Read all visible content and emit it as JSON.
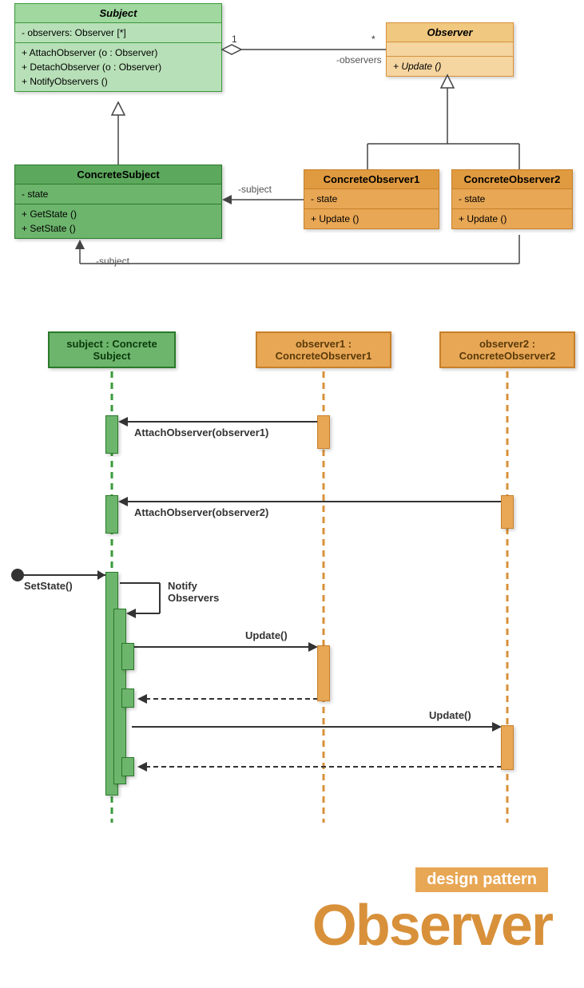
{
  "classes": {
    "subject": {
      "name": "Subject",
      "attrs": [
        "- observers: Observer [*]"
      ],
      "ops": [
        "+ AttachObserver (o : Observer)",
        "+ DetachObserver (o : Observer)",
        "+ NotifyObservers ()"
      ]
    },
    "observer": {
      "name": "Observer",
      "ops": [
        "+ Update ()"
      ]
    },
    "concreteSubject": {
      "name": "ConcreteSubject",
      "attrs": [
        "- state"
      ],
      "ops": [
        "+ GetState ()",
        "+ SetState ()"
      ]
    },
    "concreteObserver1": {
      "name": "ConcreteObserver1",
      "attrs": [
        "- state"
      ],
      "ops": [
        "+ Update ()"
      ]
    },
    "concreteObserver2": {
      "name": "ConcreteObserver2",
      "attrs": [
        "- state"
      ],
      "ops": [
        "+ Update ()"
      ]
    }
  },
  "assoc": {
    "subject_observer": {
      "mult_left": "1",
      "mult_right": "*",
      "role": "-observers"
    },
    "co1_cs": {
      "role": "-subject"
    },
    "co2_cs": {
      "role": "-subject"
    }
  },
  "sequence": {
    "lifelines": {
      "subject": "subject : Concrete Subject",
      "observer1": "observer1 : ConcreteObserver1",
      "observer2": "observer2 : ConcreteObserver2"
    },
    "messages": {
      "attach1": "AttachObserver(observer1)",
      "attach2": "AttachObserver(observer2)",
      "setstate": "SetState()",
      "notify": "Notify Observers",
      "update1": "Update()",
      "update2": "Update()"
    }
  },
  "title": {
    "sub": "design pattern",
    "main": "Observer"
  }
}
